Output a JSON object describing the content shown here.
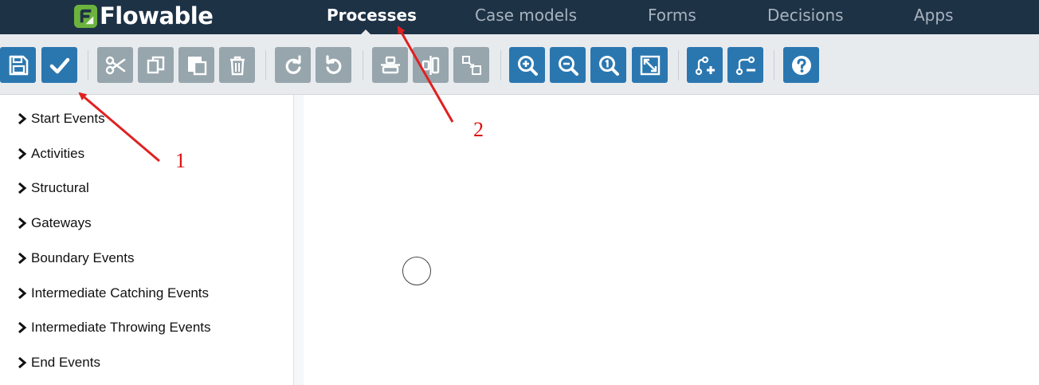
{
  "header": {
    "logo_text": "Flowable",
    "nav": [
      {
        "label": "Processes",
        "active": true
      },
      {
        "label": "Case models",
        "active": false
      },
      {
        "label": "Forms",
        "active": false
      },
      {
        "label": "Decisions",
        "active": false
      },
      {
        "label": "Apps",
        "active": false
      }
    ]
  },
  "toolbar": {
    "buttons": [
      {
        "icon": "save-icon",
        "color": "blue"
      },
      {
        "icon": "validate-icon",
        "color": "blue"
      },
      {
        "icon": "cut-icon",
        "color": "gray"
      },
      {
        "icon": "copy-icon",
        "color": "gray"
      },
      {
        "icon": "paste-icon",
        "color": "gray"
      },
      {
        "icon": "delete-icon",
        "color": "gray"
      },
      {
        "icon": "redo-icon",
        "color": "gray"
      },
      {
        "icon": "undo-icon",
        "color": "gray"
      },
      {
        "icon": "align-vertical-icon",
        "color": "gray"
      },
      {
        "icon": "align-horizontal-icon",
        "color": "gray"
      },
      {
        "icon": "same-size-icon",
        "color": "gray"
      },
      {
        "icon": "zoom-in-icon",
        "color": "blue"
      },
      {
        "icon": "zoom-out-icon",
        "color": "blue"
      },
      {
        "icon": "zoom-actual-icon",
        "color": "blue"
      },
      {
        "icon": "zoom-fit-icon",
        "color": "blue"
      },
      {
        "icon": "add-bendpoint-icon",
        "color": "blue"
      },
      {
        "icon": "remove-bendpoint-icon",
        "color": "blue"
      },
      {
        "icon": "help-icon",
        "color": "blue"
      }
    ]
  },
  "palette": {
    "groups": [
      "Start Events",
      "Activities",
      "Structural",
      "Gateways",
      "Boundary Events",
      "Intermediate Catching Events",
      "Intermediate Throwing Events",
      "End Events"
    ]
  },
  "annotations": {
    "label_1": "1",
    "label_2": "2",
    "color": "#d11111"
  },
  "colors": {
    "header_bg": "#1e3246",
    "toolbar_bg": "#e8ebee",
    "button_blue": "#2a77b0",
    "button_gray": "#97a5ad",
    "logo_green": "#6cb33e"
  }
}
